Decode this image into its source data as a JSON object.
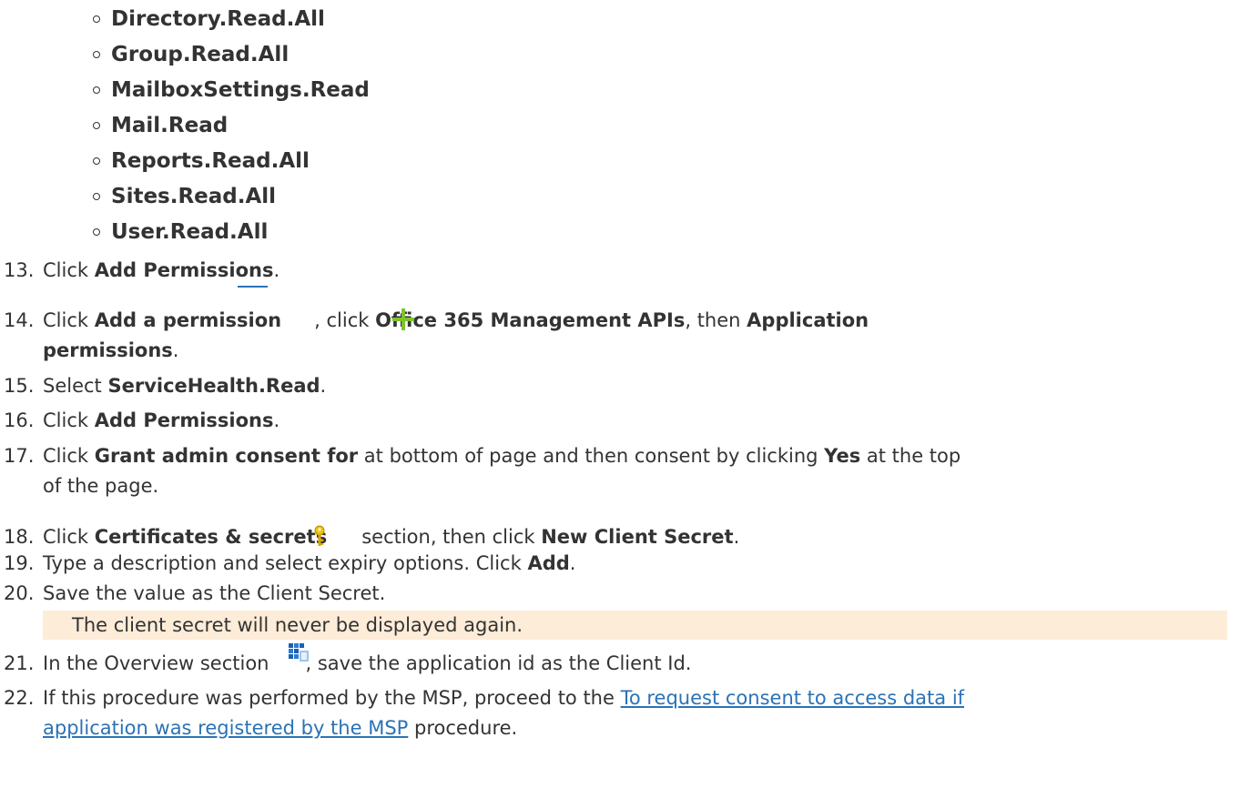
{
  "permissions": [
    "Directory.Read.All",
    "Group.Read.All",
    "MailboxSettings.Read",
    "Mail.Read",
    "Reports.Read.All",
    "Sites.Read.All",
    "User.Read.All"
  ],
  "steps": {
    "s13": {
      "num": "13.",
      "pre": "Click ",
      "b1": "Add Permissions",
      "post": "."
    },
    "s14": {
      "num": "14.",
      "pre": "Click ",
      "b1": "Add a permission",
      "mid1": ", click ",
      "b2": "Office 365 Management APIs",
      "mid2": ", then ",
      "b3": "Application",
      "b4": "permissions",
      "post": "."
    },
    "s15": {
      "num": "15.",
      "pre": "Select ",
      "b1": "ServiceHealth.Read",
      "post": "."
    },
    "s16": {
      "num": "16.",
      "pre": "Click ",
      "b1": "Add Permissions",
      "post": "."
    },
    "s17": {
      "num": "17.",
      "pre": "Click ",
      "b1": "Grant admin consent for",
      "mid1": " at bottom of page and then consent by clicking ",
      "b2": "Yes",
      "mid2": " at the top",
      "line2": "of the page."
    },
    "s18": {
      "num": "18.",
      "pre": "Click ",
      "b1": "Certificates & secrets",
      "mid1": "section, then click ",
      "b2": "New Client Secret",
      "post": "."
    },
    "s19": {
      "num": "19.",
      "pre": "Type a description and select expiry options. Click ",
      "b1": "Add",
      "post": "."
    },
    "s20": {
      "num": "20.",
      "text": "Save the value as the Client Secret."
    },
    "note": "The client secret will never be displayed again.",
    "s21": {
      "num": "21.",
      "pre": "In the Overview section",
      "post": ", save the application id as the Client Id."
    },
    "s22": {
      "num": "22.",
      "pre": "If this procedure was performed by the MSP, proceed to the ",
      "link1": "To request consent to access data if",
      "link2": "application was registered by the MSP",
      "post": " procedure."
    }
  },
  "colors": {
    "link": "#2b72b5",
    "note_bg": "#fdecd8",
    "plus": "#7cc42b",
    "key": "#f2c200"
  },
  "icons": [
    "plus-icon",
    "key-icon",
    "app-registration-icon"
  ]
}
